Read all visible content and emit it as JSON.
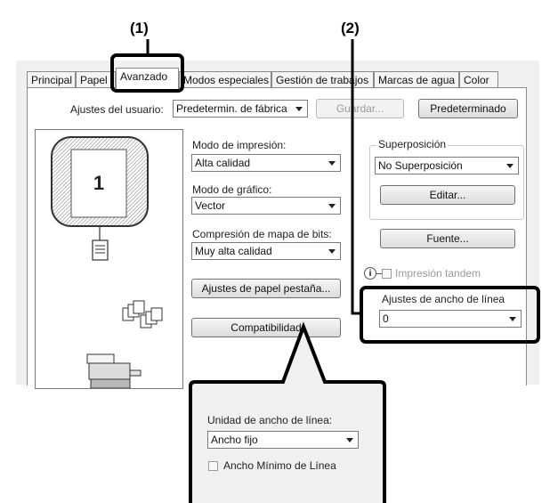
{
  "callouts": {
    "c1": "(1)",
    "c2": "(2)"
  },
  "tabs": [
    {
      "label": "Principal"
    },
    {
      "label": "Papel"
    },
    {
      "label": "Avanzado"
    },
    {
      "label": "Modos especiales"
    },
    {
      "label": "Gestión de trabajos"
    },
    {
      "label": "Marcas de agua"
    },
    {
      "label": "Color"
    }
  ],
  "user_settings": {
    "label": "Ajustes del usuario:",
    "value": "Predetermin. de fábrica",
    "save": "Guardar...",
    "default": "Predeterminado"
  },
  "preview": {
    "page_number": "1"
  },
  "print_mode": {
    "label": "Modo de impresión:",
    "value": "Alta calidad"
  },
  "graphics_mode": {
    "label": "Modo de gráfico:",
    "value": "Vector"
  },
  "bitmap_compression": {
    "label": "Compresión de mapa de bits:",
    "value": "Muy alta calidad"
  },
  "tab_paper_button": "Ajustes de papel pestaña...",
  "compat_button": "Compatibilidad",
  "overlay": {
    "title": "Superposición",
    "value": "No Superposición",
    "edit": "Editar..."
  },
  "font_button": "Fuente...",
  "tandem": {
    "label": "Impresión tandem"
  },
  "line_width": {
    "label": "Ajustes de ancho de línea",
    "value": "0"
  },
  "popup": {
    "unit_label": "Unidad de ancho de línea:",
    "unit_value": "Ancho fijo",
    "min_label": "Ancho Mínimo de Línea"
  },
  "colors": {
    "accent": "#000000",
    "dialog_bg": "#f0f0f0"
  }
}
